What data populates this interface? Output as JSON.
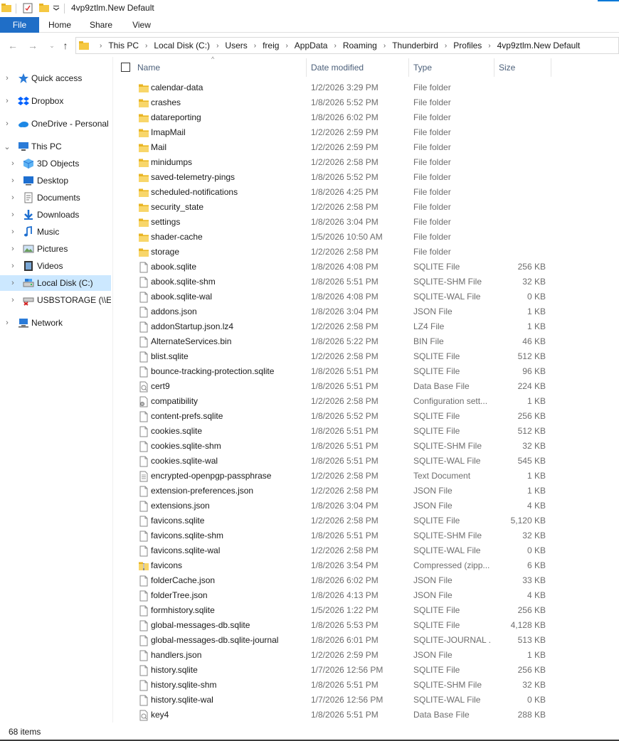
{
  "window": {
    "title": "4vp9ztlm.New Default"
  },
  "ribbon": {
    "tabs": [
      {
        "label": "File"
      },
      {
        "label": "Home"
      },
      {
        "label": "Share"
      },
      {
        "label": "View"
      }
    ]
  },
  "address": {
    "crumbs": [
      "This PC",
      "Local Disk (C:)",
      "Users",
      "freig",
      "AppData",
      "Roaming",
      "Thunderbird",
      "Profiles",
      "4vp9ztlm.New Default"
    ]
  },
  "nav": {
    "items": [
      {
        "label": "Quick access",
        "icon": "star-icon"
      },
      {
        "label": "Dropbox",
        "icon": "dropbox-icon"
      },
      {
        "label": "OneDrive - Personal",
        "icon": "cloud-icon"
      },
      {
        "label": "This PC",
        "icon": "computer-icon"
      },
      {
        "label": "3D Objects",
        "icon": "cube-icon"
      },
      {
        "label": "Desktop",
        "icon": "desktop-icon"
      },
      {
        "label": "Documents",
        "icon": "document-icon"
      },
      {
        "label": "Downloads",
        "icon": "download-icon"
      },
      {
        "label": "Music",
        "icon": "music-icon"
      },
      {
        "label": "Pictures",
        "icon": "picture-icon"
      },
      {
        "label": "Videos",
        "icon": "video-icon"
      },
      {
        "label": "Local Disk (C:)",
        "icon": "drive-icon"
      },
      {
        "label": "USBSTORAGE (\\\\EPS",
        "icon": "network-drive-icon"
      },
      {
        "label": "Network",
        "icon": "network-icon"
      }
    ]
  },
  "columns": {
    "name": "Name",
    "date": "Date modified",
    "type": "Type",
    "size": "Size"
  },
  "files": [
    {
      "name": "calendar-data",
      "date": "1/2/2026 3:29 PM",
      "type": "File folder",
      "size": "",
      "kind": "folder"
    },
    {
      "name": "crashes",
      "date": "1/8/2026 5:52 PM",
      "type": "File folder",
      "size": "",
      "kind": "folder"
    },
    {
      "name": "datareporting",
      "date": "1/8/2026 6:02 PM",
      "type": "File folder",
      "size": "",
      "kind": "folder"
    },
    {
      "name": "ImapMail",
      "date": "1/2/2026 2:59 PM",
      "type": "File folder",
      "size": "",
      "kind": "folder"
    },
    {
      "name": "Mail",
      "date": "1/2/2026 2:59 PM",
      "type": "File folder",
      "size": "",
      "kind": "folder"
    },
    {
      "name": "minidumps",
      "date": "1/2/2026 2:58 PM",
      "type": "File folder",
      "size": "",
      "kind": "folder"
    },
    {
      "name": "saved-telemetry-pings",
      "date": "1/8/2026 5:52 PM",
      "type": "File folder",
      "size": "",
      "kind": "folder"
    },
    {
      "name": "scheduled-notifications",
      "date": "1/8/2026 4:25 PM",
      "type": "File folder",
      "size": "",
      "kind": "folder"
    },
    {
      "name": "security_state",
      "date": "1/2/2026 2:58 PM",
      "type": "File folder",
      "size": "",
      "kind": "folder"
    },
    {
      "name": "settings",
      "date": "1/8/2026 3:04 PM",
      "type": "File folder",
      "size": "",
      "kind": "folder"
    },
    {
      "name": "shader-cache",
      "date": "1/5/2026 10:50 AM",
      "type": "File folder",
      "size": "",
      "kind": "folder"
    },
    {
      "name": "storage",
      "date": "1/2/2026 2:58 PM",
      "type": "File folder",
      "size": "",
      "kind": "folder"
    },
    {
      "name": "abook.sqlite",
      "date": "1/8/2026 4:08 PM",
      "type": "SQLITE File",
      "size": "256 KB",
      "kind": "file"
    },
    {
      "name": "abook.sqlite-shm",
      "date": "1/8/2026 5:51 PM",
      "type": "SQLITE-SHM File",
      "size": "32 KB",
      "kind": "file"
    },
    {
      "name": "abook.sqlite-wal",
      "date": "1/8/2026 4:08 PM",
      "type": "SQLITE-WAL File",
      "size": "0 KB",
      "kind": "file"
    },
    {
      "name": "addons.json",
      "date": "1/8/2026 3:04 PM",
      "type": "JSON File",
      "size": "1 KB",
      "kind": "file"
    },
    {
      "name": "addonStartup.json.lz4",
      "date": "1/2/2026 2:58 PM",
      "type": "LZ4 File",
      "size": "1 KB",
      "kind": "file"
    },
    {
      "name": "AlternateServices.bin",
      "date": "1/8/2026 5:22 PM",
      "type": "BIN File",
      "size": "46 KB",
      "kind": "file"
    },
    {
      "name": "blist.sqlite",
      "date": "1/2/2026 2:58 PM",
      "type": "SQLITE File",
      "size": "512 KB",
      "kind": "file"
    },
    {
      "name": "bounce-tracking-protection.sqlite",
      "date": "1/8/2026 5:51 PM",
      "type": "SQLITE File",
      "size": "96 KB",
      "kind": "file"
    },
    {
      "name": "cert9",
      "date": "1/8/2026 5:51 PM",
      "type": "Data Base File",
      "size": "224 KB",
      "kind": "db"
    },
    {
      "name": "compatibility",
      "date": "1/2/2026 2:58 PM",
      "type": "Configuration sett...",
      "size": "1 KB",
      "kind": "config"
    },
    {
      "name": "content-prefs.sqlite",
      "date": "1/8/2026 5:52 PM",
      "type": "SQLITE File",
      "size": "256 KB",
      "kind": "file"
    },
    {
      "name": "cookies.sqlite",
      "date": "1/8/2026 5:51 PM",
      "type": "SQLITE File",
      "size": "512 KB",
      "kind": "file"
    },
    {
      "name": "cookies.sqlite-shm",
      "date": "1/8/2026 5:51 PM",
      "type": "SQLITE-SHM File",
      "size": "32 KB",
      "kind": "file"
    },
    {
      "name": "cookies.sqlite-wal",
      "date": "1/8/2026 5:51 PM",
      "type": "SQLITE-WAL File",
      "size": "545 KB",
      "kind": "file"
    },
    {
      "name": "encrypted-openpgp-passphrase",
      "date": "1/2/2026 2:58 PM",
      "type": "Text Document",
      "size": "1 KB",
      "kind": "text"
    },
    {
      "name": "extension-preferences.json",
      "date": "1/2/2026 2:58 PM",
      "type": "JSON File",
      "size": "1 KB",
      "kind": "file"
    },
    {
      "name": "extensions.json",
      "date": "1/8/2026 3:04 PM",
      "type": "JSON File",
      "size": "4 KB",
      "kind": "file"
    },
    {
      "name": "favicons.sqlite",
      "date": "1/2/2026 2:58 PM",
      "type": "SQLITE File",
      "size": "5,120 KB",
      "kind": "file"
    },
    {
      "name": "favicons.sqlite-shm",
      "date": "1/8/2026 5:51 PM",
      "type": "SQLITE-SHM File",
      "size": "32 KB",
      "kind": "file"
    },
    {
      "name": "favicons.sqlite-wal",
      "date": "1/2/2026 2:58 PM",
      "type": "SQLITE-WAL File",
      "size": "0 KB",
      "kind": "file"
    },
    {
      "name": "favicons",
      "date": "1/8/2026 3:54 PM",
      "type": "Compressed (zipp...",
      "size": "6 KB",
      "kind": "zip"
    },
    {
      "name": "folderCache.json",
      "date": "1/8/2026 6:02 PM",
      "type": "JSON File",
      "size": "33 KB",
      "kind": "file"
    },
    {
      "name": "folderTree.json",
      "date": "1/8/2026 4:13 PM",
      "type": "JSON File",
      "size": "4 KB",
      "kind": "file"
    },
    {
      "name": "formhistory.sqlite",
      "date": "1/5/2026 1:22 PM",
      "type": "SQLITE File",
      "size": "256 KB",
      "kind": "file"
    },
    {
      "name": "global-messages-db.sqlite",
      "date": "1/8/2026 5:53 PM",
      "type": "SQLITE File",
      "size": "4,128 KB",
      "kind": "file"
    },
    {
      "name": "global-messages-db.sqlite-journal",
      "date": "1/8/2026 6:01 PM",
      "type": "SQLITE-JOURNAL ...",
      "size": "513 KB",
      "kind": "file"
    },
    {
      "name": "handlers.json",
      "date": "1/2/2026 2:59 PM",
      "type": "JSON File",
      "size": "1 KB",
      "kind": "file"
    },
    {
      "name": "history.sqlite",
      "date": "1/7/2026 12:56 PM",
      "type": "SQLITE File",
      "size": "256 KB",
      "kind": "file"
    },
    {
      "name": "history.sqlite-shm",
      "date": "1/8/2026 5:51 PM",
      "type": "SQLITE-SHM File",
      "size": "32 KB",
      "kind": "file"
    },
    {
      "name": "history.sqlite-wal",
      "date": "1/7/2026 12:56 PM",
      "type": "SQLITE-WAL File",
      "size": "0 KB",
      "kind": "file"
    },
    {
      "name": "key4",
      "date": "1/8/2026 5:51 PM",
      "type": "Data Base File",
      "size": "288 KB",
      "kind": "db"
    }
  ],
  "status": {
    "item_count": "68 items"
  }
}
